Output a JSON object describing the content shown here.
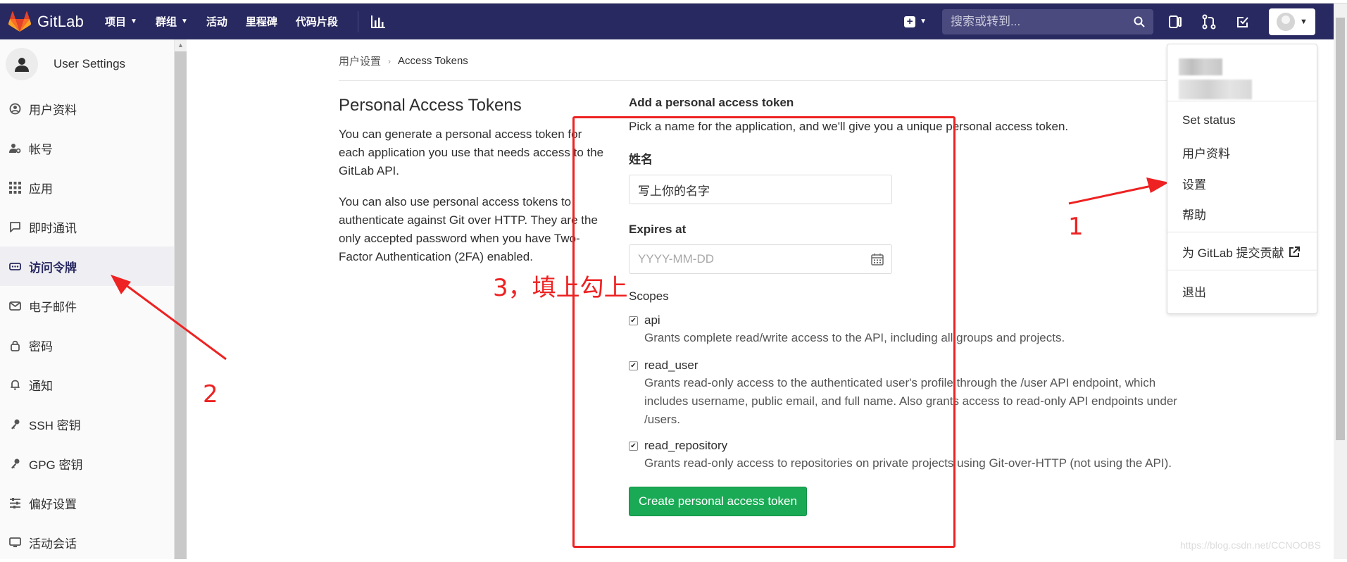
{
  "navbar": {
    "brand": "GitLab",
    "items": [
      {
        "label": "项目",
        "has_caret": true
      },
      {
        "label": "群组",
        "has_caret": true
      },
      {
        "label": "活动",
        "has_caret": false
      },
      {
        "label": "里程碑",
        "has_caret": false
      },
      {
        "label": "代码片段",
        "has_caret": false
      }
    ],
    "search_placeholder": "搜索或转到...",
    "bg_color": "#292961"
  },
  "sidebar": {
    "title": "User Settings",
    "items": [
      {
        "label": "用户资料",
        "icon": "profile-icon"
      },
      {
        "label": "帐号",
        "icon": "account-icon"
      },
      {
        "label": "应用",
        "icon": "applications-icon"
      },
      {
        "label": "即时通讯",
        "icon": "chat-icon"
      },
      {
        "label": "访问令牌",
        "icon": "token-icon",
        "active": true
      },
      {
        "label": "电子邮件",
        "icon": "email-icon"
      },
      {
        "label": "密码",
        "icon": "lock-icon"
      },
      {
        "label": "通知",
        "icon": "bell-icon"
      },
      {
        "label": "SSH 密钥",
        "icon": "key-icon"
      },
      {
        "label": "GPG 密钥",
        "icon": "key-icon"
      },
      {
        "label": "偏好设置",
        "icon": "preferences-icon"
      },
      {
        "label": "活动会话",
        "icon": "monitor-icon"
      }
    ]
  },
  "breadcrumb": {
    "parent": "用户设置",
    "current": "Access Tokens"
  },
  "intro": {
    "title": "Personal Access Tokens",
    "p1": "You can generate a personal access token for each application you use that needs access to the GitLab API.",
    "p2": "You can also use personal access tokens to authenticate against Git over HTTP. They are the only accepted password when you have Two-Factor Authentication (2FA) enabled."
  },
  "form": {
    "heading": "Add a personal access token",
    "description": "Pick a name for the application, and we'll give you a unique personal access token.",
    "name_label": "姓名",
    "name_value": "写上你的名字",
    "expires_label": "Expires at",
    "expires_placeholder": "YYYY-MM-DD",
    "scopes_label": "Scopes",
    "scopes": [
      {
        "name": "api",
        "checked": true,
        "desc": "Grants complete read/write access to the API, including all groups and projects."
      },
      {
        "name": "read_user",
        "checked": true,
        "desc": "Grants read-only access to the authenticated user's profile through the /user API endpoint, which includes username, public email, and full name. Also grants access to read-only API endpoints under /users."
      },
      {
        "name": "read_repository",
        "checked": true,
        "desc": "Grants read-only access to repositories on private projects using Git-over-HTTP (not using the API)."
      }
    ],
    "submit_label": "Create personal access token",
    "submit_color": "#1aaa55"
  },
  "dropdown": {
    "items": [
      "Set status",
      "用户资料",
      "设置",
      "帮助",
      "为 GitLab 提交贡献",
      "退出"
    ]
  },
  "annotations": {
    "step1": "1",
    "step2": "2",
    "step3": "3，填上勾上",
    "color": "#ee2222"
  },
  "watermark": "https://blog.csdn.net/CCNOOBS"
}
